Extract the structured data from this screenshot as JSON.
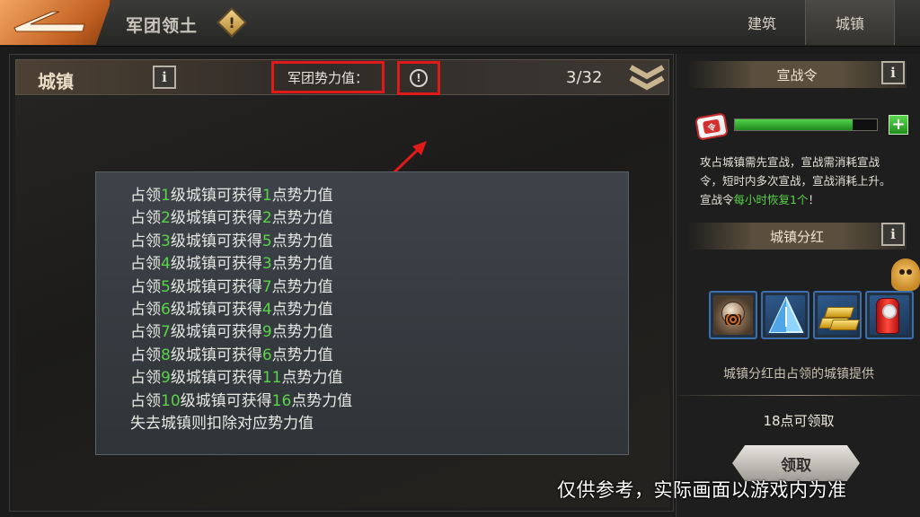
{
  "header": {
    "title": "军团领土",
    "tabs": [
      {
        "label": "建筑",
        "active": false
      },
      {
        "label": "城镇",
        "active": true
      }
    ]
  },
  "town_bar": {
    "title": "城镇",
    "info_glyph": "i",
    "power_label": "军团势力值：",
    "power_icon_glyph": "!",
    "count": "3/32"
  },
  "tooltip": {
    "lines": [
      {
        "pre": "占领",
        "n1": "1",
        "mid": "级城镇可获得",
        "n2": "1",
        "post": "点势力值"
      },
      {
        "pre": "占领",
        "n1": "2",
        "mid": "级城镇可获得",
        "n2": "2",
        "post": "点势力值"
      },
      {
        "pre": "占领",
        "n1": "3",
        "mid": "级城镇可获得",
        "n2": "5",
        "post": "点势力值"
      },
      {
        "pre": "占领",
        "n1": "4",
        "mid": "级城镇可获得",
        "n2": "3",
        "post": "点势力值"
      },
      {
        "pre": "占领",
        "n1": "5",
        "mid": "级城镇可获得",
        "n2": "7",
        "post": "点势力值"
      },
      {
        "pre": "占领",
        "n1": "6",
        "mid": "级城镇可获得",
        "n2": "4",
        "post": "点势力值"
      },
      {
        "pre": "占领",
        "n1": "7",
        "mid": "级城镇可获得",
        "n2": "9",
        "post": "点势力值"
      },
      {
        "pre": "占领",
        "n1": "8",
        "mid": "级城镇可获得",
        "n2": "6",
        "post": "点势力值"
      },
      {
        "pre": "占领",
        "n1": "9",
        "mid": "级城镇可获得",
        "n2": "11",
        "post": "点势力值"
      },
      {
        "pre": "占领",
        "n1": "10",
        "mid": "级城镇可获得",
        "n2": "16",
        "post": "点势力值"
      }
    ],
    "last_line": "失去城镇则扣除对应势力值"
  },
  "war_order": {
    "title": "宣战令",
    "progress": 0.83,
    "plus_glyph": "+",
    "token_glyph": "令",
    "desc_part1": "攻占城镇需先宣战，宣战需消耗宣战令，短时内多次宣战，宣战消耗上升。宣战令",
    "desc_green": "每小时恢复1个",
    "desc_part2": "！"
  },
  "bonus": {
    "title": "城镇分红",
    "rewards": [
      "orb-item-icon",
      "crystal-item-icon",
      "gold-bars-icon",
      "red-canister-icon"
    ],
    "desc": "城镇分红由占领的城镇提供",
    "points_text": "18点可领取",
    "claim_label": "领取"
  },
  "watermark": "仅供参考，实际画面以游戏内为准",
  "colors": {
    "highlight_red": "#e01a1a",
    "value_green": "#5ad24a",
    "accent_orange": "#c05f21"
  }
}
